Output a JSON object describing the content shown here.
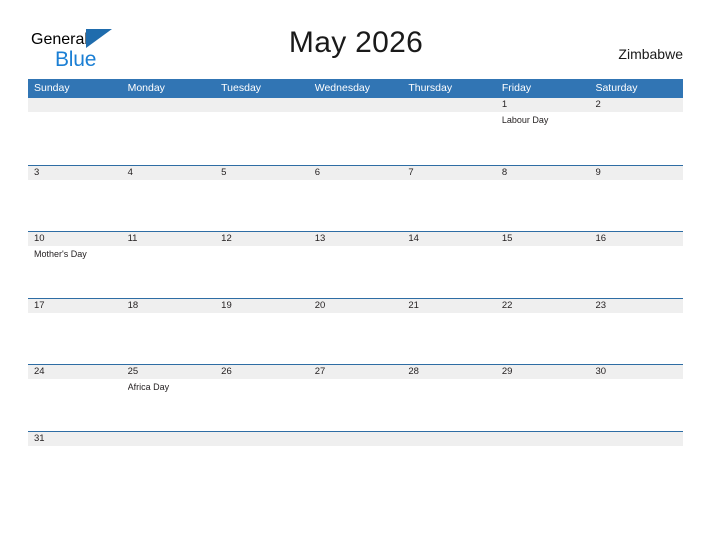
{
  "brand": {
    "word_one": "General",
    "word_two": "Blue",
    "flag_icon": "flag-triangle-icon",
    "accent_dark": "#1f6cad",
    "accent_blue": "#1b7fd4"
  },
  "header": {
    "title": "May 2026",
    "country": "Zimbabwe"
  },
  "theme": {
    "header_blue": "#3175b4",
    "row_divider": "#2e6da4",
    "date_band_gray": "#efefef",
    "text": "#231f20"
  },
  "calendar": {
    "weekdays": [
      "Sunday",
      "Monday",
      "Tuesday",
      "Wednesday",
      "Thursday",
      "Friday",
      "Saturday"
    ],
    "weeks": [
      [
        {
          "date": "",
          "events": []
        },
        {
          "date": "",
          "events": []
        },
        {
          "date": "",
          "events": []
        },
        {
          "date": "",
          "events": []
        },
        {
          "date": "",
          "events": []
        },
        {
          "date": "1",
          "events": [
            "Labour Day"
          ]
        },
        {
          "date": "2",
          "events": []
        }
      ],
      [
        {
          "date": "3",
          "events": []
        },
        {
          "date": "4",
          "events": []
        },
        {
          "date": "5",
          "events": []
        },
        {
          "date": "6",
          "events": []
        },
        {
          "date": "7",
          "events": []
        },
        {
          "date": "8",
          "events": []
        },
        {
          "date": "9",
          "events": []
        }
      ],
      [
        {
          "date": "10",
          "events": [
            "Mother's Day"
          ]
        },
        {
          "date": "11",
          "events": []
        },
        {
          "date": "12",
          "events": []
        },
        {
          "date": "13",
          "events": []
        },
        {
          "date": "14",
          "events": []
        },
        {
          "date": "15",
          "events": []
        },
        {
          "date": "16",
          "events": []
        }
      ],
      [
        {
          "date": "17",
          "events": []
        },
        {
          "date": "18",
          "events": []
        },
        {
          "date": "19",
          "events": []
        },
        {
          "date": "20",
          "events": []
        },
        {
          "date": "21",
          "events": []
        },
        {
          "date": "22",
          "events": []
        },
        {
          "date": "23",
          "events": []
        }
      ],
      [
        {
          "date": "24",
          "events": []
        },
        {
          "date": "25",
          "events": [
            "Africa Day"
          ]
        },
        {
          "date": "26",
          "events": []
        },
        {
          "date": "27",
          "events": []
        },
        {
          "date": "28",
          "events": []
        },
        {
          "date": "29",
          "events": []
        },
        {
          "date": "30",
          "events": []
        }
      ],
      [
        {
          "date": "31",
          "events": []
        },
        {
          "date": "",
          "events": []
        },
        {
          "date": "",
          "events": []
        },
        {
          "date": "",
          "events": []
        },
        {
          "date": "",
          "events": []
        },
        {
          "date": "",
          "events": []
        },
        {
          "date": "",
          "events": []
        }
      ]
    ]
  }
}
